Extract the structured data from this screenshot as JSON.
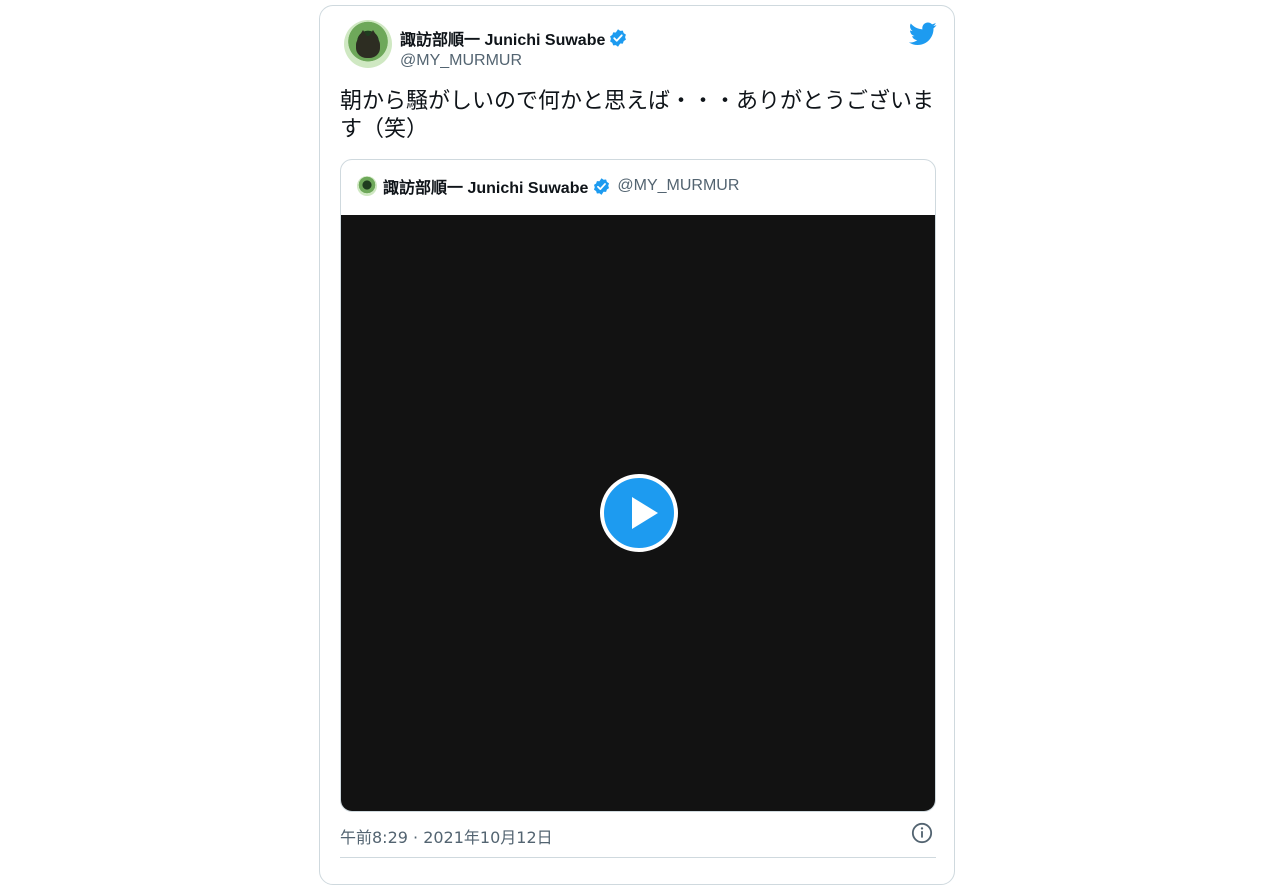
{
  "tweet": {
    "author_name": "諏訪部順一 Junichi Suwabe",
    "author_handle": "@MY_MURMUR",
    "text": "朝から騒がしいので何かと思えば・・・ありがとうございます（笑）",
    "timestamp": "午前8:29 · 2021年10月12日"
  },
  "quoted_tweet": {
    "author_name": "諏訪部順一 Junichi Suwabe",
    "author_handle": "@MY_MURMUR"
  },
  "icons": {
    "brand": "twitter-bird-icon",
    "verified": "verified-badge-icon",
    "play": "play-icon",
    "info": "info-icon"
  },
  "colors": {
    "accent": "#1d9bf0",
    "text": "#0f1419",
    "secondary_text": "#536471",
    "border": "#cfd9de",
    "video_bg": "#121212"
  }
}
